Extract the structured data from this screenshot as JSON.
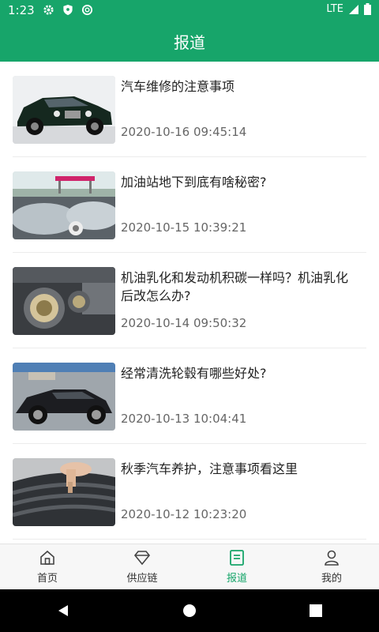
{
  "status_bar": {
    "time": "1:23",
    "network": "LTE"
  },
  "app_bar": {
    "title": "报道"
  },
  "articles": [
    {
      "title": "汽车维修的注意事项",
      "date": "2020-10-16 09:45:14",
      "thumb_kind": "car-front"
    },
    {
      "title": "加油站地下到底有啥秘密?",
      "date": "2020-10-15 10:39:21",
      "thumb_kind": "fuel-tanks"
    },
    {
      "title": "机油乳化和发动机积碳一样吗？机油乳化后改怎么办?",
      "date": "2020-10-14 09:50:32",
      "thumb_kind": "engine"
    },
    {
      "title": "经常清洗轮毂有哪些好处?",
      "date": "2020-10-13 10:04:41",
      "thumb_kind": "car-side"
    },
    {
      "title": "秋季汽车养护，注意事项看这里",
      "date": "2020-10-12 10:23:20",
      "thumb_kind": "tire"
    }
  ],
  "tabs": [
    {
      "label": "首页",
      "icon": "home-icon",
      "active": false
    },
    {
      "label": "供应链",
      "icon": "diamond-icon",
      "active": false
    },
    {
      "label": "报道",
      "icon": "report-icon",
      "active": true
    },
    {
      "label": "我的",
      "icon": "user-icon",
      "active": false
    }
  ],
  "colors": {
    "primary": "#17a56a",
    "text": "#222222",
    "subtext": "#666666"
  }
}
